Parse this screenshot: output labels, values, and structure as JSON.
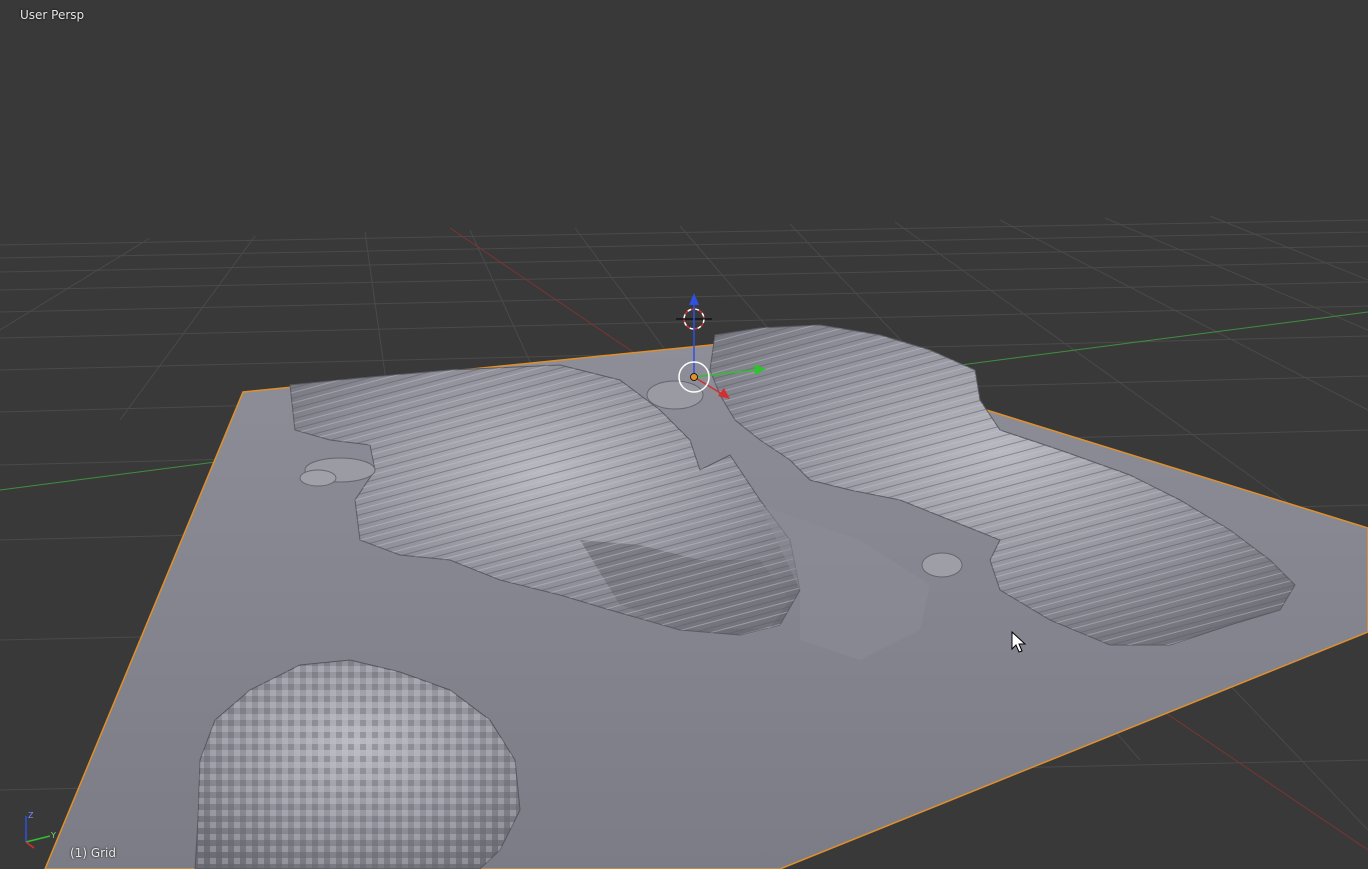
{
  "viewport": {
    "view_label": "User Persp",
    "active_object_label": "(1) Grid"
  },
  "axis_widget": {
    "z_label": "Z",
    "y_label": "Y",
    "x_color": "#d03030",
    "y_color": "#30c030",
    "z_color": "#3050e0"
  },
  "colors": {
    "background": "#393939",
    "grid_line": "#4a4a4a",
    "x_axis_line": "#8a3a3a",
    "y_axis_line": "#3f8f3f",
    "selection_outline": "#e0902a",
    "terrain_base": "#8a8a94"
  },
  "icons": {
    "cursor": "mouse-pointer-icon",
    "3d_cursor": "3d-cursor-icon",
    "origin": "object-origin-icon"
  }
}
